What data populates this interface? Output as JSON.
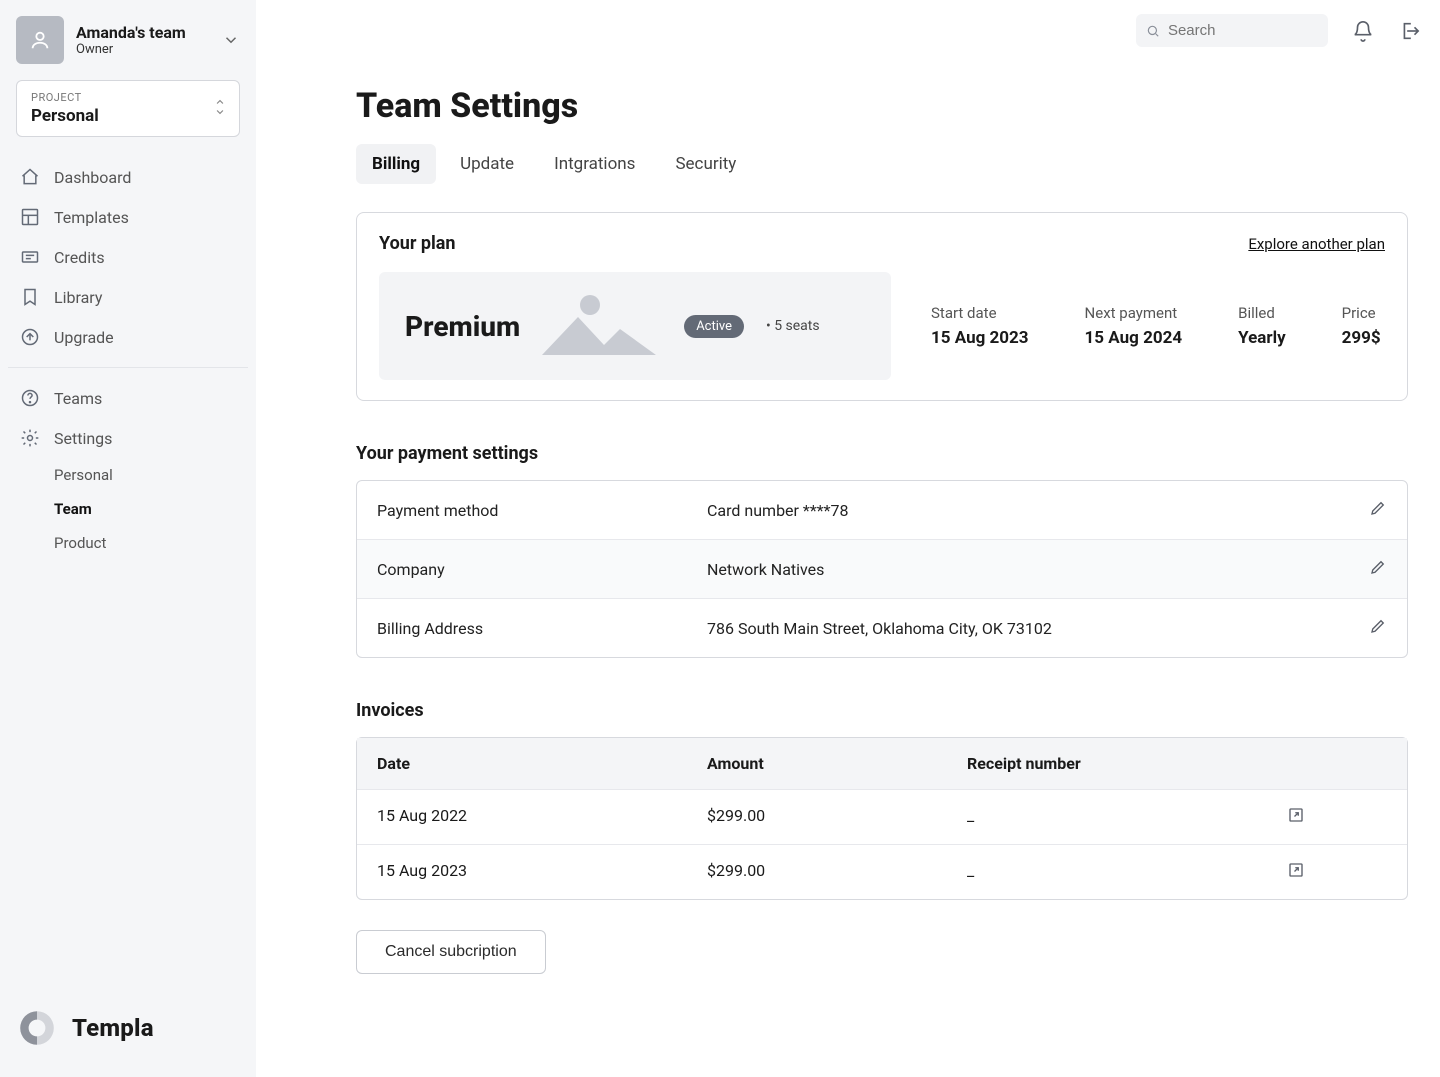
{
  "team_switcher": {
    "name": "Amanda's team",
    "role": "Owner"
  },
  "project_selector": {
    "caption": "PROJECT",
    "value": "Personal"
  },
  "nav1": [
    {
      "label": "Dashboard"
    },
    {
      "label": "Templates"
    },
    {
      "label": "Credits"
    },
    {
      "label": "Library"
    },
    {
      "label": "Upgrade"
    }
  ],
  "nav2": [
    {
      "label": "Teams"
    },
    {
      "label": "Settings"
    }
  ],
  "settings_sub": [
    {
      "label": "Personal"
    },
    {
      "label": "Team",
      "active": true
    },
    {
      "label": "Product"
    }
  ],
  "brand": "Templa",
  "search": {
    "placeholder": "Search"
  },
  "page": {
    "title": "Team Settings"
  },
  "tabs": [
    {
      "label": "Billing",
      "active": true
    },
    {
      "label": "Update"
    },
    {
      "label": "Intgrations"
    },
    {
      "label": "Security"
    }
  ],
  "plan_panel": {
    "title": "Your plan",
    "explore": "Explore another plan",
    "plan_name": "Premium",
    "status": "Active",
    "seats": "• 5 seats",
    "facts": [
      {
        "label": "Start date",
        "value": "15 Aug 2023"
      },
      {
        "label": "Next payment",
        "value": "15 Aug 2024"
      },
      {
        "label": "Billed",
        "value": "Yearly"
      },
      {
        "label": "Price",
        "value": "299$"
      }
    ]
  },
  "payment_section": {
    "title": "Your payment settings",
    "rows": [
      {
        "k": "Payment method",
        "v": "Card number ****78"
      },
      {
        "k": "Company",
        "v": "Network Natives"
      },
      {
        "k": "Billing Address",
        "v": "786 South Main Street, Oklahoma City, OK 73102"
      }
    ]
  },
  "invoices_section": {
    "title": "Invoices",
    "columns": {
      "date": "Date",
      "amount": "Amount",
      "receipt": "Receipt number"
    },
    "rows": [
      {
        "date": "15 Aug 2022",
        "amount": "$299.00",
        "receipt": "_"
      },
      {
        "date": "15 Aug 2023",
        "amount": "$299.00",
        "receipt": "_"
      }
    ]
  },
  "cancel_label": "Cancel subcription"
}
